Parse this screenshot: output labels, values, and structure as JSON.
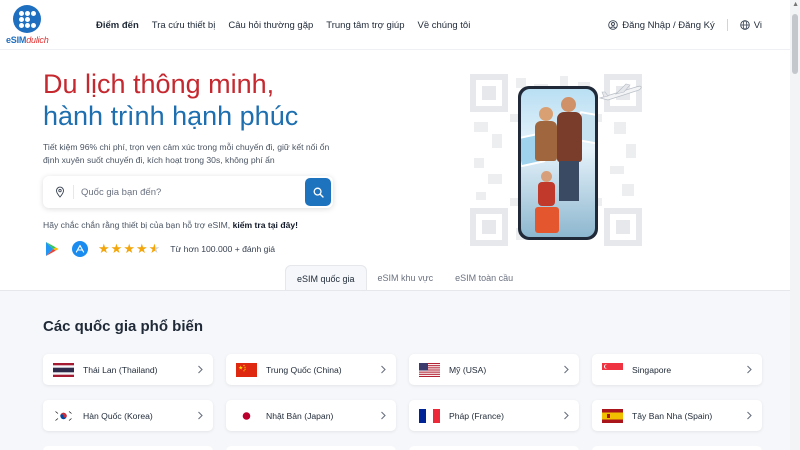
{
  "brand": {
    "logo_text_main": "eSIM",
    "logo_text_accent": "dulich",
    "primary_color": "#1e6fc0",
    "accent_color": "#c5282f"
  },
  "nav": {
    "items": [
      {
        "label": "Điểm đến",
        "active": true
      },
      {
        "label": "Tra cứu thiết bị"
      },
      {
        "label": "Câu hỏi thường gặp"
      },
      {
        "label": "Trung tâm trợ giúp"
      },
      {
        "label": "Về chúng tôi"
      }
    ]
  },
  "header_right": {
    "login_label": "Đăng Nhập / Đăng Ký",
    "language_label": "Vi"
  },
  "hero": {
    "title_line1": "Du lịch thông minh,",
    "title_line2": "hành trình hạnh phúc",
    "description": "Tiết kiệm 96% chi phí, trọn vẹn cảm xúc trong mỗi chuyến đi, giữ kết nối ổn định xuyên suốt chuyến đi, kích hoạt trong 30s, không phí ẩn",
    "search_placeholder": "Quốc gia bạn đến?",
    "check_text": "Hãy chắc chắn rằng thiết bị của bạn hỗ trợ eSIM,",
    "check_link": "kiểm tra tại đây!",
    "rating": 4.5,
    "rating_text": "Từ hơn 100.000 + đánh giá"
  },
  "tabs": [
    {
      "label": "eSIM quốc gia",
      "active": true
    },
    {
      "label": "eSIM khu vực"
    },
    {
      "label": "eSIM toàn cầu"
    }
  ],
  "popular": {
    "title": "Các quốc gia phổ biến",
    "countries": [
      {
        "label": "Thái Lan (Thailand)",
        "flag": "thailand-flag"
      },
      {
        "label": "Trung Quốc (China)",
        "flag": "china-flag"
      },
      {
        "label": "Mỹ (USA)",
        "flag": "usa-flag"
      },
      {
        "label": "Singapore",
        "flag": "singapore-flag"
      },
      {
        "label": "Hàn Quốc (Korea)",
        "flag": "korea-flag"
      },
      {
        "label": "Nhật Bản (Japan)",
        "flag": "japan-flag"
      },
      {
        "label": "Pháp (France)",
        "flag": "france-flag"
      },
      {
        "label": "Tây Ban Nha (Spain)",
        "flag": "spain-flag"
      }
    ]
  }
}
